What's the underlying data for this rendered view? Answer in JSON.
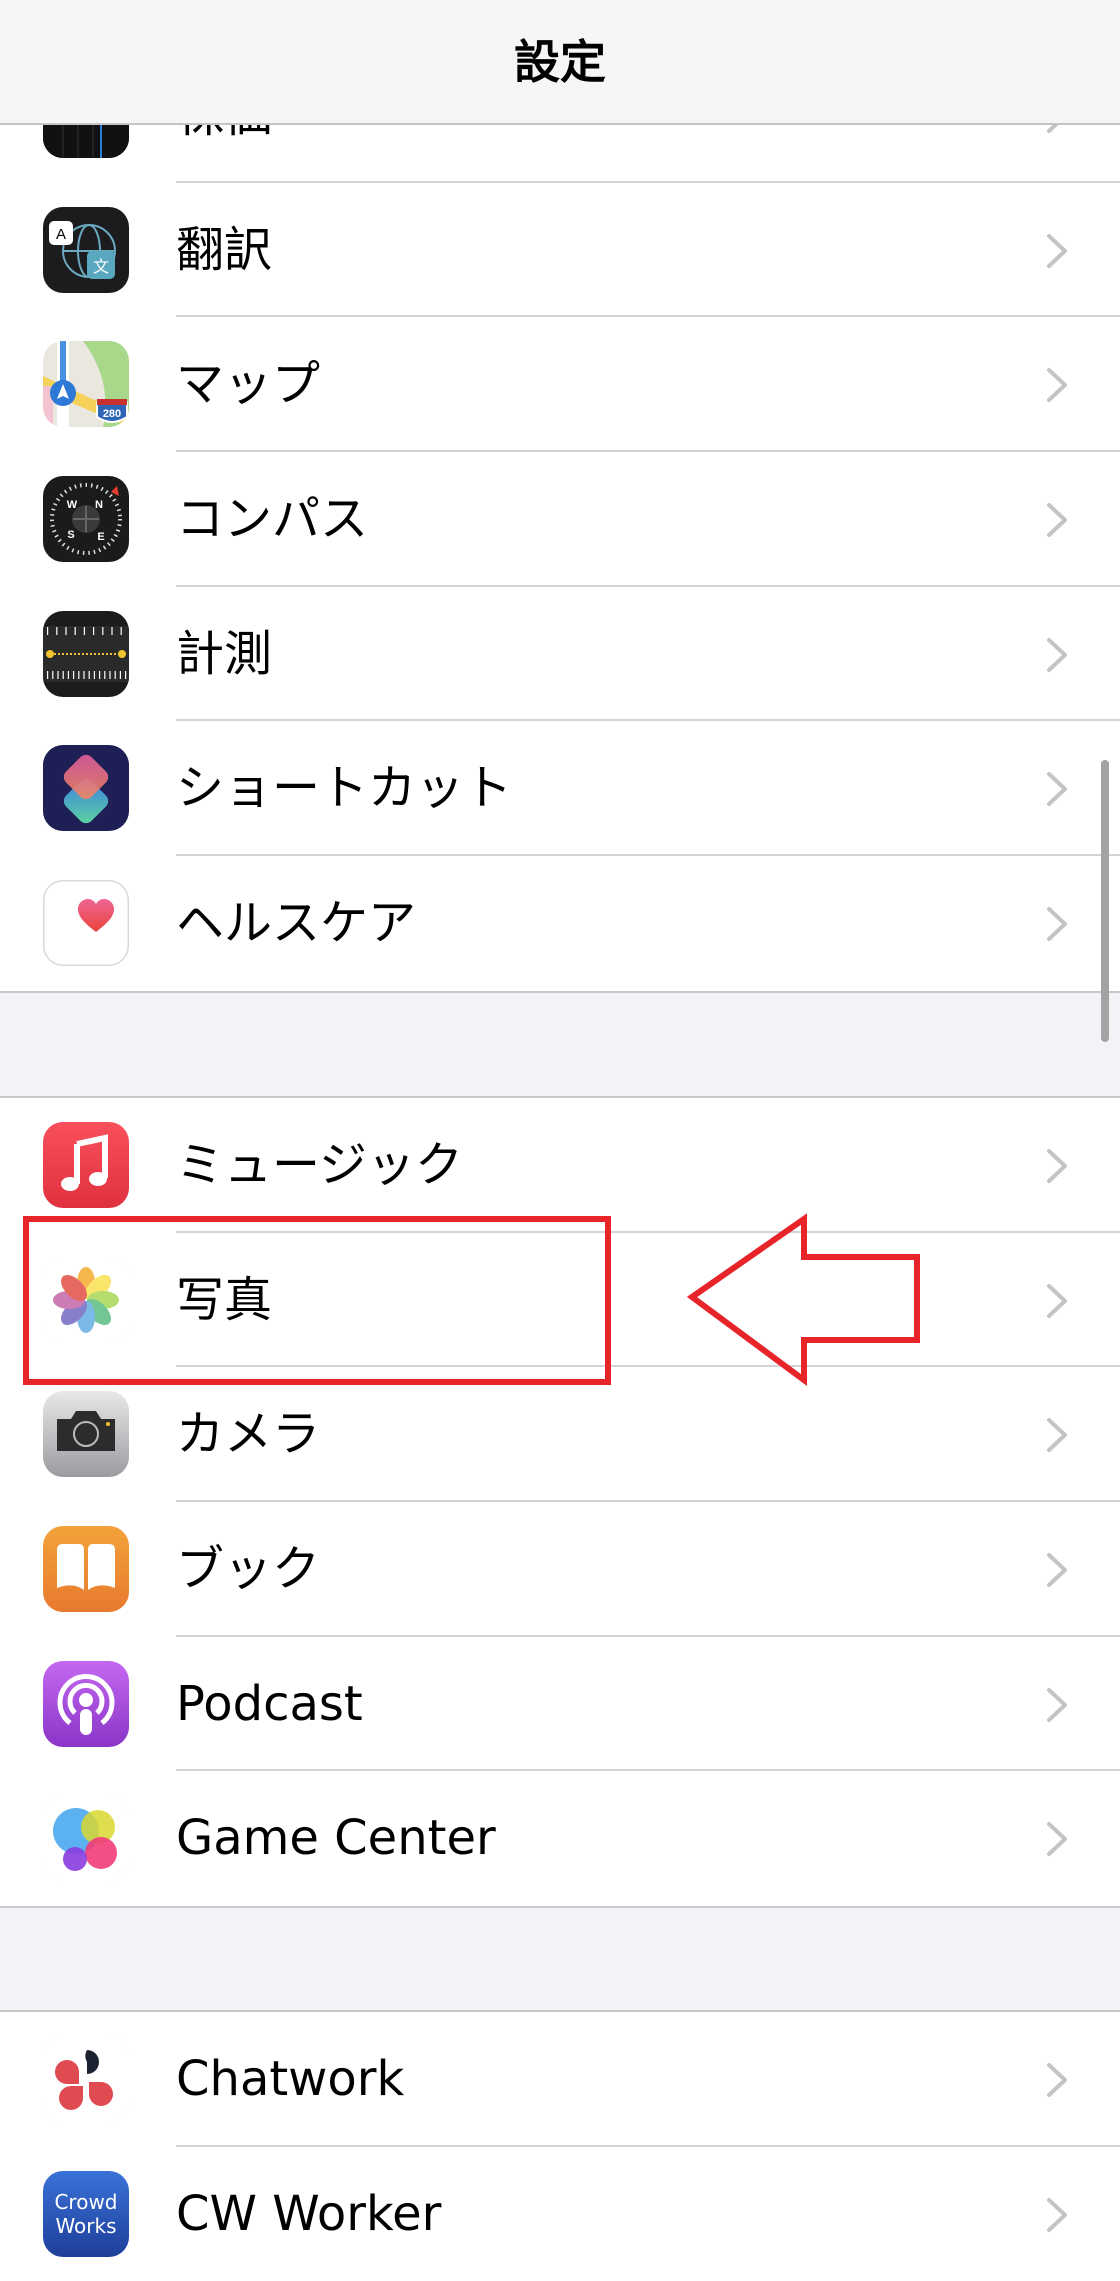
{
  "navbar": {
    "title": "設定"
  },
  "groups": [
    {
      "items": [
        {
          "label": "株価",
          "icon": "stocks-icon"
        },
        {
          "label": "翻訳",
          "icon": "translate-icon"
        },
        {
          "label": "マップ",
          "icon": "maps-icon",
          "badge": "280"
        },
        {
          "label": "コンパス",
          "icon": "compass-icon",
          "compass": [
            "N",
            "E",
            "S",
            "W"
          ]
        },
        {
          "label": "計測",
          "icon": "measure-icon"
        },
        {
          "label": "ショートカット",
          "icon": "shortcuts-icon"
        },
        {
          "label": "ヘルスケア",
          "icon": "health-icon"
        }
      ]
    },
    {
      "items": [
        {
          "label": "ミュージック",
          "icon": "music-icon"
        },
        {
          "label": "写真",
          "icon": "photos-icon",
          "highlighted": true
        },
        {
          "label": "カメラ",
          "icon": "camera-icon"
        },
        {
          "label": "ブック",
          "icon": "books-icon"
        },
        {
          "label": "Podcast",
          "icon": "podcast-icon"
        },
        {
          "label": "Game Center",
          "icon": "game-center-icon"
        }
      ]
    },
    {
      "items": [
        {
          "label": "Chatwork",
          "icon": "chatwork-icon"
        },
        {
          "label": "CW Worker",
          "icon": "cw-worker-icon",
          "icon_text": [
            "Crowd",
            "Works"
          ]
        }
      ]
    }
  ],
  "translate_icon_text": {
    "a": "A",
    "b": "文"
  },
  "annotation": {
    "color": "#e8242b",
    "target": "写真"
  },
  "colors": {
    "chevron": "#c4c4c7",
    "separator": "#d4d4d8",
    "background": "#f2f2f7"
  }
}
